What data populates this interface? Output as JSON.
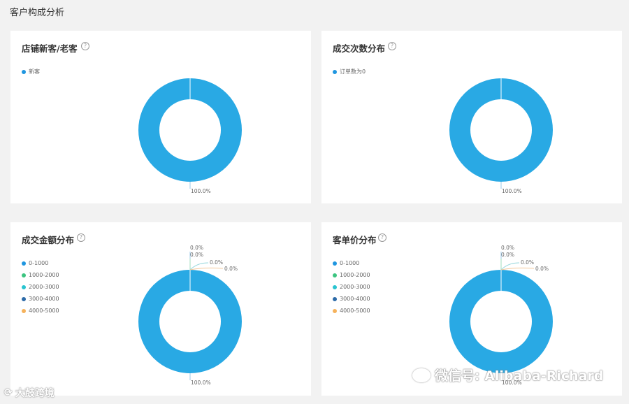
{
  "page": {
    "title": "客户构成分析"
  },
  "cards": [
    {
      "title": "店铺新客/老客",
      "legend": [
        {
          "label": "新客",
          "color": "#1f96e0"
        }
      ]
    },
    {
      "title": "成交次数分布",
      "legend": [
        {
          "label": "订单数为0",
          "color": "#1f96e0"
        }
      ]
    },
    {
      "title": "成交金额分布",
      "legend": [
        {
          "label": "0-1000",
          "color": "#1f96e0"
        },
        {
          "label": "1000-2000",
          "color": "#3cc480"
        },
        {
          "label": "2000-3000",
          "color": "#29c4d0"
        },
        {
          "label": "3000-4000",
          "color": "#2d6ba8"
        },
        {
          "label": "4000-5000",
          "color": "#f5b25c"
        }
      ]
    },
    {
      "title": "客单价分布",
      "legend": [
        {
          "label": "0-1000",
          "color": "#1f96e0"
        },
        {
          "label": "1000-2000",
          "color": "#3cc480"
        },
        {
          "label": "2000-3000",
          "color": "#29c4d0"
        },
        {
          "label": "3000-4000",
          "color": "#2d6ba8"
        },
        {
          "label": "4000-5000",
          "color": "#f5b25c"
        }
      ]
    }
  ],
  "chart_data": [
    {
      "type": "pie",
      "title": "店铺新客/老客",
      "categories": [
        "新客"
      ],
      "values": [
        100.0
      ],
      "labels": [
        "100.0%"
      ],
      "ring_color": "#29a9e4"
    },
    {
      "type": "pie",
      "title": "成交次数分布",
      "categories": [
        "订单数为0"
      ],
      "values": [
        100.0
      ],
      "labels": [
        "100.0%"
      ],
      "ring_color": "#29a9e4"
    },
    {
      "type": "pie",
      "title": "成交金额分布",
      "categories": [
        "0-1000",
        "1000-2000",
        "2000-3000",
        "3000-4000",
        "4000-5000"
      ],
      "values": [
        100.0,
        0.0,
        0.0,
        0.0,
        0.0
      ],
      "labels": [
        "100.0%",
        "0.0%",
        "0.0%",
        "0.0%",
        "0.0%"
      ],
      "ring_color": "#29a9e4"
    },
    {
      "type": "pie",
      "title": "客单价分布",
      "categories": [
        "0-1000",
        "1000-2000",
        "2000-3000",
        "3000-4000",
        "4000-5000"
      ],
      "values": [
        100.0,
        0.0,
        0.0,
        0.0,
        0.0
      ],
      "labels": [
        "100.0%",
        "0.0%",
        "0.0%",
        "0.0%",
        "0.0%"
      ],
      "ring_color": "#29a9e4"
    }
  ],
  "watermarks": {
    "left": "大鼓跨境",
    "right": "微信号: Alibaba-Richard"
  }
}
